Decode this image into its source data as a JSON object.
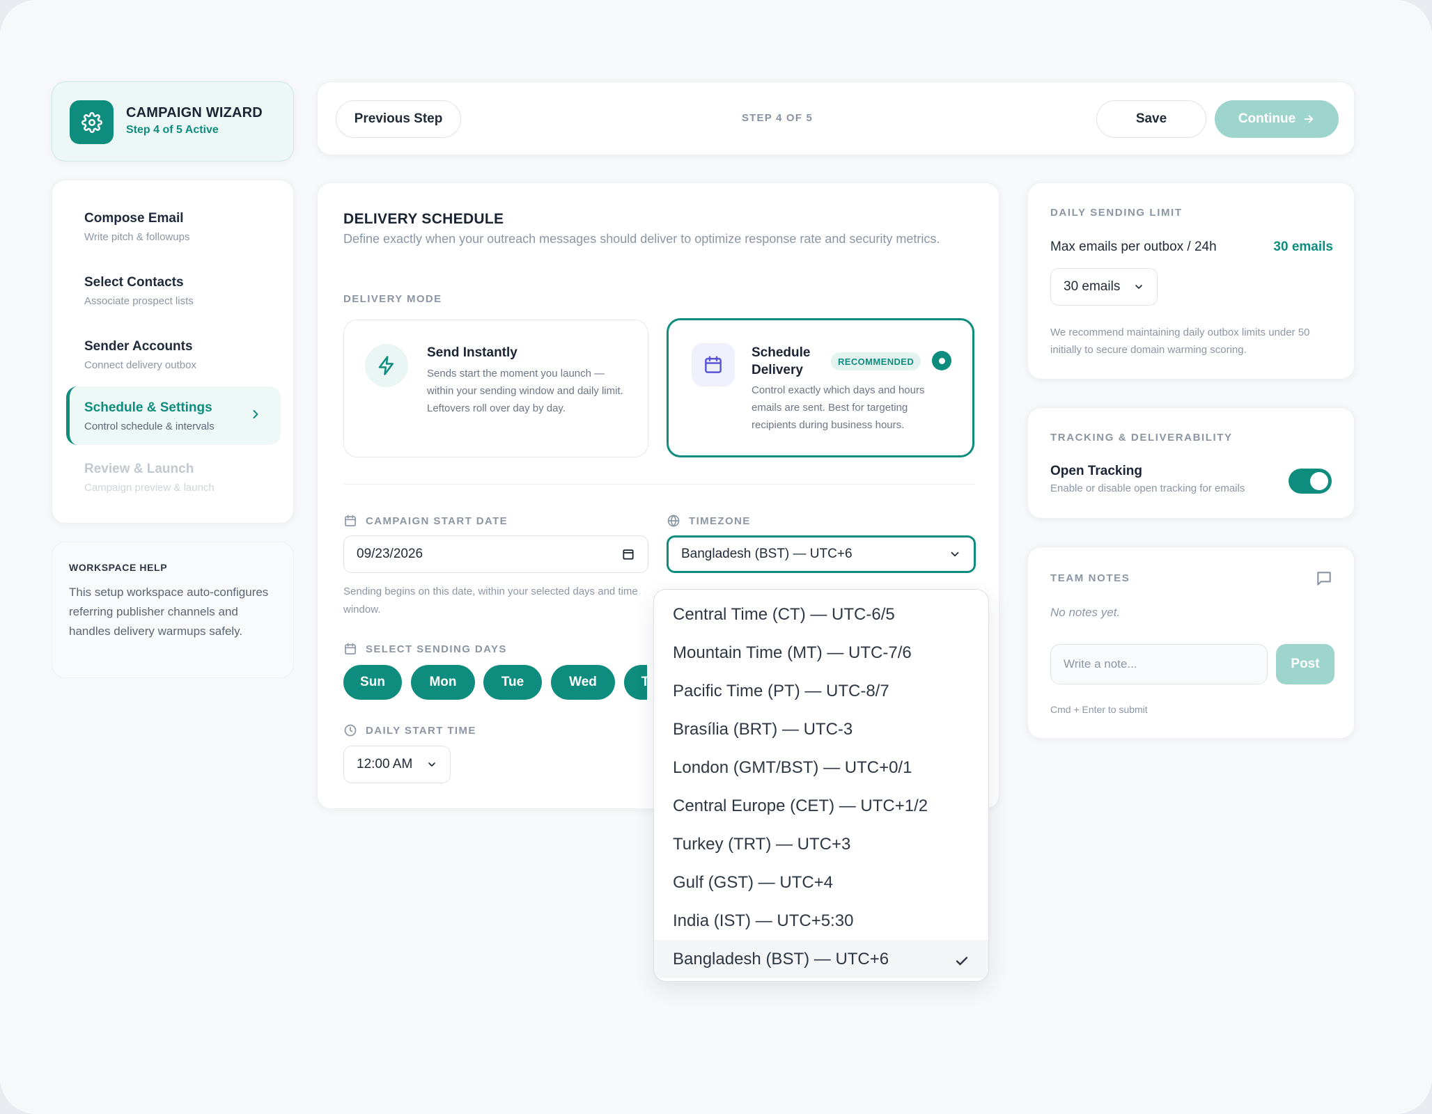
{
  "wizard": {
    "title": "CAMPAIGN WIZARD",
    "subtitle": "Step 4 of 5 Active",
    "accent": "#0e8c7e"
  },
  "steps": [
    {
      "label": "Compose Email",
      "desc": "Write pitch & followups",
      "state": "done"
    },
    {
      "label": "Select Contacts",
      "desc": "Associate prospect lists",
      "state": "done"
    },
    {
      "label": "Sender Accounts",
      "desc": "Connect delivery outbox",
      "state": "done"
    },
    {
      "label": "Schedule & Settings",
      "desc": "Control schedule & intervals",
      "state": "active"
    },
    {
      "label": "Review & Launch",
      "desc": "Campaign preview & launch",
      "state": "disabled"
    }
  ],
  "help": {
    "title": "WORKSPACE HELP",
    "text": "This setup workspace auto-configures referring publisher channels and handles delivery warmups safely."
  },
  "topbar": {
    "previous_label": "Previous Step",
    "step_indicator": "STEP 4 OF 5",
    "save_label": "Save",
    "continue_label": "Continue"
  },
  "schedule": {
    "title": "DELIVERY SCHEDULE",
    "subtitle": "Define exactly when your outreach messages should deliver to optimize response rate and security metrics.",
    "mode_label": "DELIVERY MODE",
    "modes": [
      {
        "title": "Send Instantly",
        "desc": "Sends start the moment you launch — within your sending window and daily limit. Leftovers roll over day by day.",
        "selected": false
      },
      {
        "title": "Schedule Delivery",
        "badge": "RECOMMENDED",
        "desc": "Control exactly which days and hours emails are sent. Best for targeting recipients during business hours.",
        "selected": true
      }
    ],
    "start_date_label": "CAMPAIGN START DATE",
    "start_date_value": "09/23/2026",
    "start_date_hint": "Sending begins on this date, within your selected days and time window.",
    "timezone_label": "TIMEZONE",
    "timezone_value": "Bangladesh (BST) — UTC+6",
    "days_label": "SELECT SENDING DAYS",
    "days": [
      "Sun",
      "Mon",
      "Tue",
      "Wed",
      "Thu"
    ],
    "start_time_label": "DAILY START TIME",
    "start_time_value": "12:00 AM"
  },
  "timezone_dropdown": {
    "options": [
      "Central Time (CT) — UTC-6/5",
      "Mountain Time (MT) — UTC-7/6",
      "Pacific Time (PT) — UTC-8/7",
      "Brasília (BRT) — UTC-3",
      "London (GMT/BST) — UTC+0/1",
      "Central Europe (CET) — UTC+1/2",
      "Turkey (TRT) — UTC+3",
      "Gulf (GST) — UTC+4",
      "India (IST) — UTC+5:30",
      "Bangladesh (BST) — UTC+6"
    ],
    "selected": "Bangladesh (BST) — UTC+6"
  },
  "limit": {
    "title": "DAILY SENDING LIMIT",
    "label": "Max emails per outbox / 24h",
    "value": "30 emails",
    "select_value": "30 emails",
    "note": "We recommend maintaining daily outbox limits under 50 initially to secure domain warming scoring."
  },
  "tracking": {
    "title": "TRACKING & DELIVERABILITY",
    "label": "Open Tracking",
    "desc": "Enable or disable open tracking for emails",
    "enabled": true
  },
  "notes": {
    "title": "TEAM NOTES",
    "empty": "No notes yet.",
    "placeholder": "Write a note...",
    "post_label": "Post",
    "hint": "Cmd + Enter to submit"
  }
}
